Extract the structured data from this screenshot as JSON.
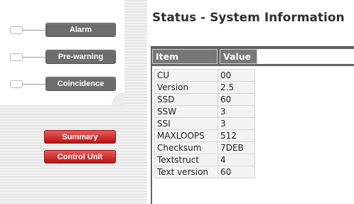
{
  "title": "Status - System Information",
  "indicators": [
    {
      "label": "Alarm"
    },
    {
      "label": "Pre-warning"
    },
    {
      "label": "Coincidence"
    }
  ],
  "nav_buttons": [
    {
      "label": "Summary"
    },
    {
      "label": "Control Unit"
    }
  ],
  "table": {
    "headers": [
      "Item",
      "Value"
    ],
    "rows": [
      [
        "CU",
        "00"
      ],
      [
        "Version",
        "2.5"
      ],
      [
        "SSD",
        "60"
      ],
      [
        "SSW",
        "3"
      ],
      [
        "SSI",
        "3"
      ],
      [
        "MAXLOOPS",
        "512"
      ],
      [
        "Checksum",
        "7DEB"
      ],
      [
        "Textstruct",
        "4"
      ],
      [
        "Text version",
        "60"
      ]
    ]
  },
  "colors": {
    "indicator_button": "#6d6d6d",
    "nav_button": "#c62828",
    "header_bar": "#666666"
  }
}
